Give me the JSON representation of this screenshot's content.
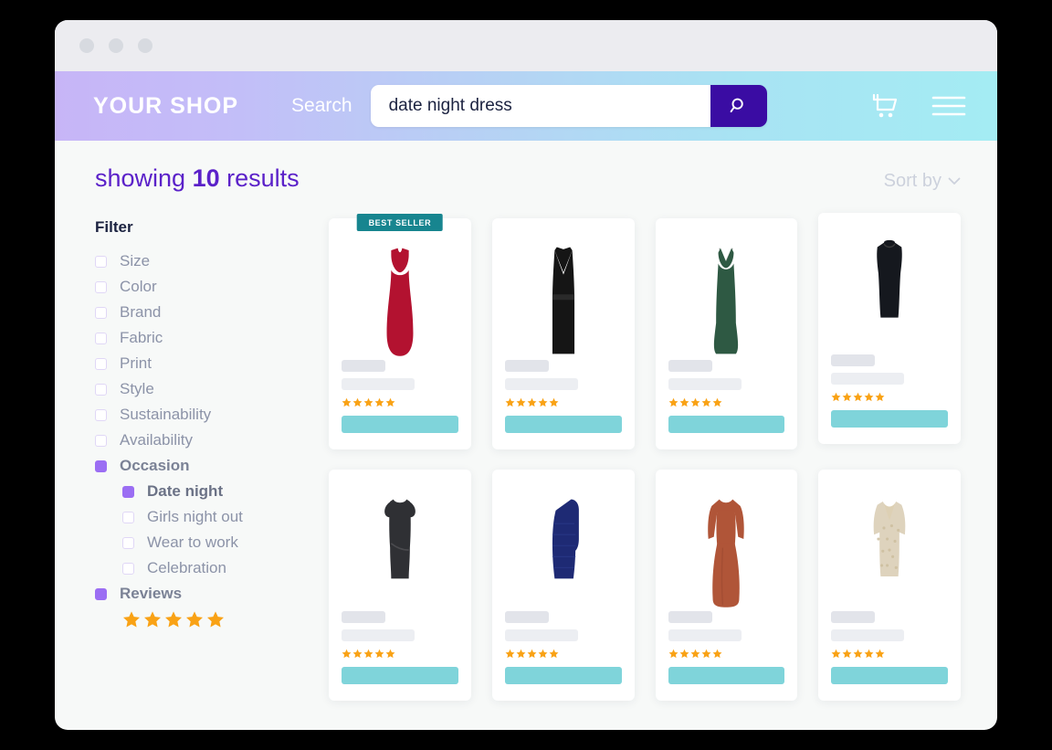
{
  "window": {
    "traffic_lights": [
      "dot-1",
      "dot-2",
      "dot-3"
    ]
  },
  "header": {
    "brand": "YOUR SHOP",
    "search_label": "Search",
    "search_value": "date night dress",
    "search_placeholder": "Search",
    "search_button_icon": "search-icon",
    "cart_icon": "shopping-cart-icon",
    "menu_icon": "hamburger-menu-icon",
    "gradient_start": "#c7b5f7",
    "gradient_end": "#a4ecf3",
    "search_button_color": "#3a0ca3"
  },
  "results": {
    "prefix": "showing",
    "count": "10",
    "suffix": "results",
    "sort_label": "Sort by",
    "sort_icon": "chevron-down-icon",
    "accent_color": "#5b21c9"
  },
  "sidebar": {
    "title": "Filter",
    "items": [
      {
        "label": "Size",
        "checked": false,
        "level": "top"
      },
      {
        "label": "Color",
        "checked": false,
        "level": "top"
      },
      {
        "label": "Brand",
        "checked": false,
        "level": "top"
      },
      {
        "label": "Fabric",
        "checked": false,
        "level": "top"
      },
      {
        "label": "Print",
        "checked": false,
        "level": "top"
      },
      {
        "label": "Style",
        "checked": false,
        "level": "top"
      },
      {
        "label": "Sustainability",
        "checked": false,
        "level": "top"
      },
      {
        "label": "Availability",
        "checked": false,
        "level": "top"
      },
      {
        "label": "Occasion",
        "checked": true,
        "level": "group"
      },
      {
        "label": "Date night",
        "checked": true,
        "level": "sub-active"
      },
      {
        "label": "Girls night out",
        "checked": false,
        "level": "sub"
      },
      {
        "label": "Wear to work",
        "checked": false,
        "level": "sub"
      },
      {
        "label": "Celebration",
        "checked": false,
        "level": "sub"
      },
      {
        "label": "Reviews",
        "checked": true,
        "level": "group"
      }
    ],
    "reviews_stars": 5,
    "checked_color": "#9b6ef3",
    "star_color": "#f9a215"
  },
  "products": [
    {
      "name": "red-midi-dress",
      "badge": "BEST SELLER",
      "stars": 5,
      "color": "#b31230",
      "offset": false
    },
    {
      "name": "black-wrap-dress",
      "badge": null,
      "stars": 5,
      "color": "#151515",
      "offset": false
    },
    {
      "name": "green-slip-dress",
      "badge": null,
      "stars": 5,
      "color": "#2e5943",
      "offset": false
    },
    {
      "name": "black-mini-dress",
      "badge": null,
      "stars": 5,
      "color": "#15181e",
      "offset": true
    },
    {
      "name": "charcoal-cap-sleeve-dress",
      "badge": null,
      "stars": 5,
      "color": "#2f3034",
      "offset": false
    },
    {
      "name": "navy-one-shoulder-dress",
      "badge": null,
      "stars": 5,
      "color": "#1e2a74",
      "offset": false
    },
    {
      "name": "rust-maxi-dress",
      "badge": null,
      "stars": 5,
      "color": "#b05538",
      "offset": false
    },
    {
      "name": "cream-lace-dress",
      "badge": null,
      "stars": 5,
      "color": "#ded3bd",
      "offset": false
    }
  ],
  "card": {
    "cta_color": "#7fd4da",
    "badge_color": "#17858f"
  }
}
